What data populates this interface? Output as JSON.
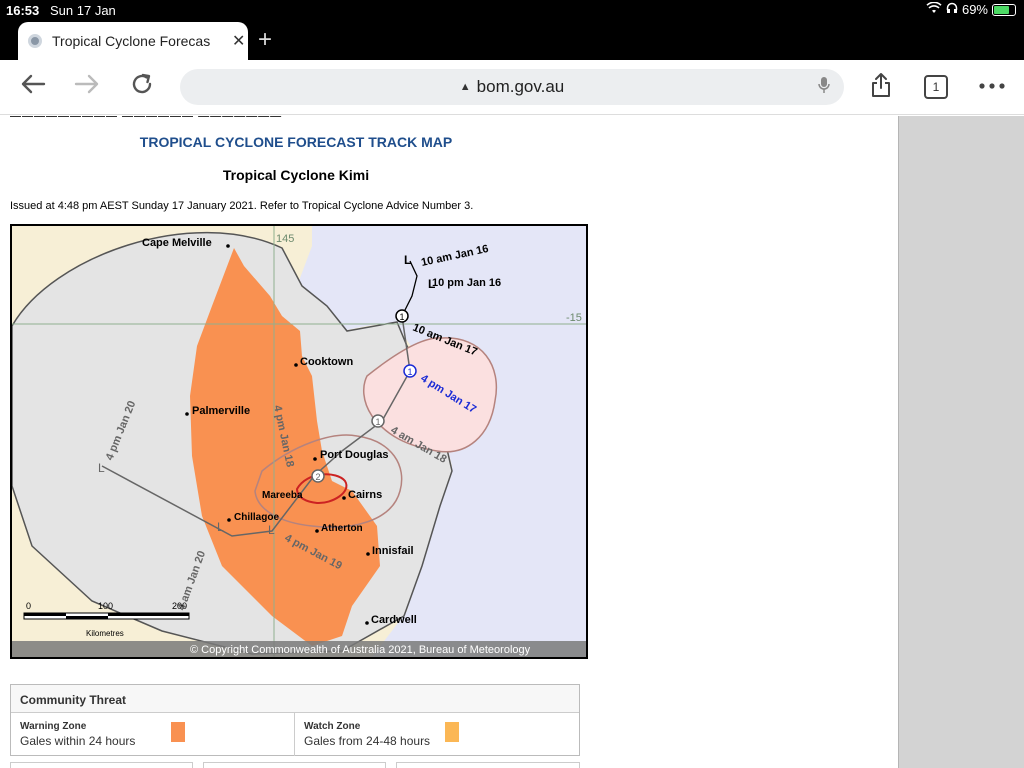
{
  "status": {
    "time": "16:53",
    "date": "Sun 17 Jan",
    "battery": "69%"
  },
  "browser": {
    "tab_title": "Tropical Cyclone Forecas",
    "url": "bom.gov.au",
    "tab_count": "1"
  },
  "page": {
    "title": "TROPICAL CYCLONE FORECAST TRACK MAP",
    "cyclone_name": "Tropical Cyclone Kimi",
    "issued": "Issued at 4:48 pm AEST Sunday 17 January 2021. Refer to Tropical Cyclone Advice Number 3."
  },
  "map": {
    "grid_labels": {
      "lon": "145",
      "lat": "-15"
    },
    "places": {
      "cape_melville": "Cape Melville",
      "cooktown": "Cooktown",
      "palmerville": "Palmerville",
      "port_douglas": "Port Douglas",
      "mareeba": "Mareeba",
      "cairns": "Cairns",
      "chillagoe": "Chillagoe",
      "atherton": "Atherton",
      "innisfail": "Innisfail",
      "cardwell": "Cardwell"
    },
    "track_labels": {
      "t1": "10 am Jan 16",
      "t2": "10 pm Jan 16",
      "t3": "10 am Jan 17",
      "t4": "4 pm Jan 17",
      "t5": "4 am Jan 18",
      "t6": "4 pm Jan 18",
      "t7": "4 pm Jan 19",
      "t8": "4 pm Jan 20",
      "t9": "4 am Jan 20"
    },
    "category_marks": {
      "c1": "1",
      "c2": "1",
      "c3": "1",
      "c4": "2"
    },
    "scale": {
      "s0": "0",
      "s100": "100",
      "s200": "200",
      "unit": "Kilometres"
    },
    "copyright": "© Copyright Commonwealth of Australia 2021, Bureau of Meteorology",
    "colors": {
      "warning_zone": "#f99151",
      "ocean": "#e4e6f7",
      "land": "#f7efd6",
      "uncertainty": "#e4e4e4"
    }
  },
  "threat": {
    "heading": "Community Threat",
    "warning_title": "Warning Zone",
    "warning_desc": "Gales within 24 hours",
    "watch_title": "Watch Zone",
    "watch_desc": "Gales from 24-48 hours",
    "warning_color": "#f99151",
    "watch_color": "#fbb755"
  }
}
